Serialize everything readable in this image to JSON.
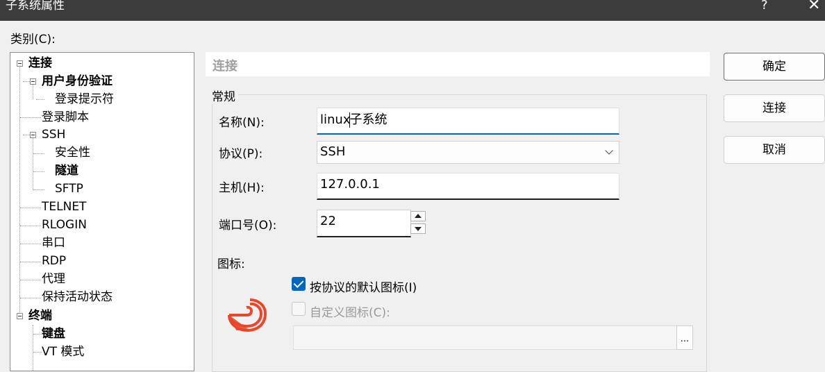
{
  "window": {
    "title": "子系统属性",
    "help_label": "?",
    "close_label": "✕"
  },
  "category_label": "类别(C):",
  "tree": {
    "items": [
      {
        "label": "连接"
      },
      {
        "label": "用户身份验证"
      },
      {
        "label": "登录提示符"
      },
      {
        "label": "登录脚本"
      },
      {
        "label": "SSH"
      },
      {
        "label": "安全性"
      },
      {
        "label": "隧道"
      },
      {
        "label": "SFTP"
      },
      {
        "label": "TELNET"
      },
      {
        "label": "RLOGIN"
      },
      {
        "label": "串口"
      },
      {
        "label": "RDP"
      },
      {
        "label": "代理"
      },
      {
        "label": "保持活动状态"
      },
      {
        "label": "终端"
      },
      {
        "label": "键盘"
      },
      {
        "label": "VT 模式"
      }
    ]
  },
  "section_header": "连接",
  "group_title": "常规",
  "form": {
    "name_label": "名称(N):",
    "name_value": "linux子系统",
    "protocol_label": "协议(P):",
    "protocol_value": "SSH",
    "host_label": "主机(H):",
    "host_value": "127.0.0.1",
    "port_label": "端口号(O):",
    "port_value": "22",
    "icon_label": "图标:",
    "default_icon_label": "按协议的默认图标(I)",
    "default_icon_checked": true,
    "custom_icon_label": "自定义图标(C):",
    "custom_icon_checked": false,
    "custom_icon_path": "",
    "browse_label": "..."
  },
  "buttons": {
    "ok": "确定",
    "connect": "连接",
    "cancel": "取消"
  },
  "colors": {
    "accent": "#0067c0",
    "icon": "#e8472c",
    "titlebar": "#3c3c3c"
  }
}
